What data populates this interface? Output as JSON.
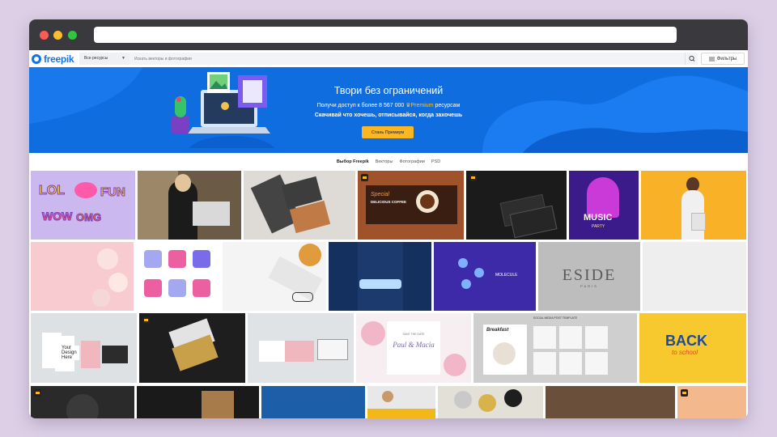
{
  "browser": {
    "url": ""
  },
  "header": {
    "logo_text": "freepik",
    "resource_select": "Все ресурсы",
    "search_placeholder": "Искать векторы и фотографии",
    "filters_label": "Фильтры"
  },
  "banner": {
    "title": "Твори без ограничений",
    "subtitle_prefix": "Получи доступ к более 8 567 000",
    "subtitle_premium": "Premium",
    "subtitle_suffix": "ресурсам",
    "subtitle2": "Скачивай что хочешь, отписывайся, когда захочешь",
    "cta": "Стань Премиум"
  },
  "tabs": [
    {
      "label": "Выбор Freepik",
      "active": true
    },
    {
      "label": "Векторы",
      "active": false
    },
    {
      "label": "Фотографии",
      "active": false
    },
    {
      "label": "PSD",
      "active": false
    }
  ],
  "tiles": {
    "lol": [
      "LOL",
      "FUN",
      "WOW",
      "OMG"
    ],
    "coffee": [
      "Special",
      "DELICIOUS COFFEE"
    ],
    "music": [
      "MUSIC",
      "PARTY"
    ],
    "molecule": "MOLECULE",
    "eside": [
      "ESIDE",
      "PARIS"
    ],
    "cards_text": "Your Design Here",
    "wedding": [
      "SAVE THE DATE",
      "Paul & Macia"
    ],
    "breakfast": [
      "SOCIAL MEDIA POST TEMPLATE",
      "Breakfast"
    ],
    "school": [
      "BACK",
      "to school"
    ]
  },
  "colors": {
    "brand": "#1273eb",
    "banner": "#0f6de0",
    "cta": "#fbb622"
  }
}
